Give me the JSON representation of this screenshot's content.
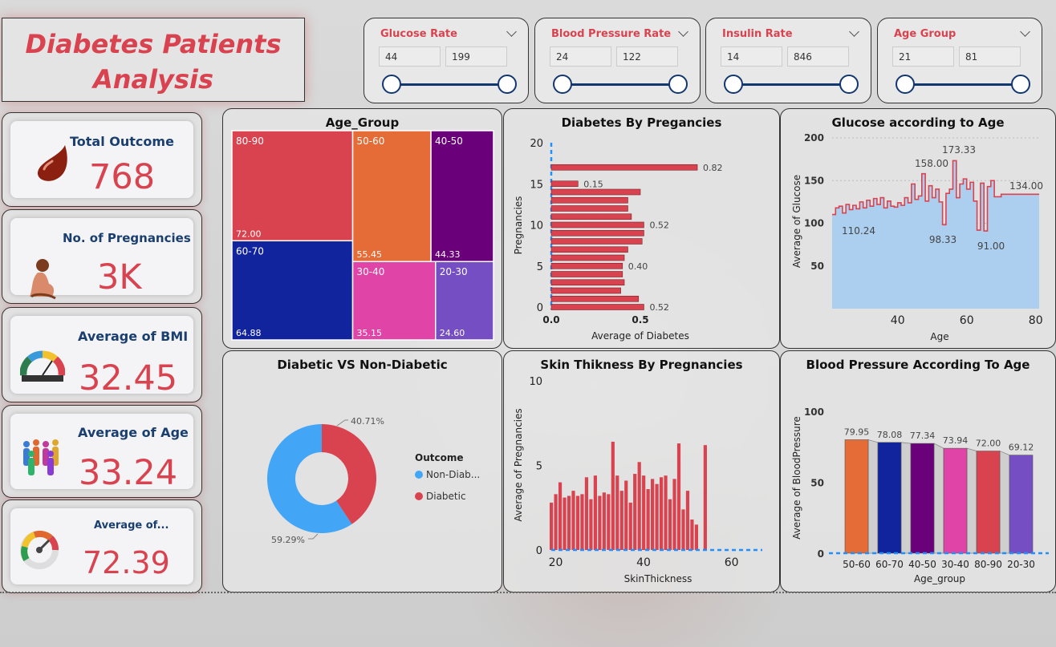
{
  "title": {
    "line1": "Diabetes Patients",
    "line2": "Analysis"
  },
  "slicers": [
    {
      "label": "Glucose Rate",
      "min": "44",
      "max": "199"
    },
    {
      "label": "Blood Pressure Rate",
      "min": "24",
      "max": "122"
    },
    {
      "label": "Insulin Rate",
      "min": "14",
      "max": "846"
    },
    {
      "label": "Age Group",
      "min": "21",
      "max": "81"
    }
  ],
  "kpis": [
    {
      "label": "Total Outcome",
      "value": "768",
      "icon": "blood-drop-icon"
    },
    {
      "label": "No. of Pregnancies",
      "value": "3K",
      "icon": "pregnant-woman-icon"
    },
    {
      "label": "Average of BMI",
      "value": "32.45",
      "icon": "bmi-gauge-icon"
    },
    {
      "label": "Average of Age",
      "value": "33.24",
      "icon": "people-icon"
    },
    {
      "label": "Average of...",
      "value": "72.39",
      "icon": "gauge-icon"
    }
  ],
  "colors": {
    "accent": "#d9434f",
    "navy": "#1a3f6f",
    "blue": "#42a5f5",
    "area": "#a9cdef"
  },
  "chart_data": [
    {
      "type": "treemap",
      "title": "Age_Group",
      "items": [
        {
          "label": "80-90",
          "value": 72.0,
          "display": "72.00",
          "color": "#d9434f"
        },
        {
          "label": "60-70",
          "value": 64.88,
          "display": "64.88",
          "color": "#12239e"
        },
        {
          "label": "50-60",
          "value": 55.45,
          "display": "55.45",
          "color": "#e66c37"
        },
        {
          "label": "40-50",
          "value": 44.33,
          "display": "44.33",
          "color": "#6b007b"
        },
        {
          "label": "30-40",
          "value": 35.15,
          "display": "35.15",
          "color": "#e044a7"
        },
        {
          "label": "20-30",
          "value": 24.6,
          "display": "24.60",
          "color": "#744ec2"
        }
      ]
    },
    {
      "type": "bar",
      "orientation": "horizontal",
      "title": "Diabetes By Pregancies",
      "xlabel": "Average of Diabetes",
      "ylabel": "Pregnancies",
      "xlim": [
        0,
        1
      ],
      "ylim": [
        0,
        20
      ],
      "xticks": [
        "0.0",
        "0.5"
      ],
      "yticks": [
        "0",
        "5",
        "10",
        "15",
        "20"
      ],
      "y": [
        0,
        1,
        2,
        3,
        4,
        5,
        6,
        7,
        8,
        9,
        10,
        11,
        12,
        13,
        14,
        15,
        17
      ],
      "values": [
        0.52,
        0.49,
        0.39,
        0.41,
        0.4,
        0.4,
        0.41,
        0.43,
        0.51,
        0.52,
        0.52,
        0.45,
        0.43,
        0.43,
        0.5,
        0.15,
        0.82
      ],
      "labels": {
        "0": "0.52",
        "5": "0.40",
        "10": "0.52",
        "15": "0.15",
        "17": "0.82"
      }
    },
    {
      "type": "area",
      "title": "Glucose according to Age",
      "xlabel": "Age",
      "ylabel": "Average of Glucose",
      "xlim": [
        21,
        81
      ],
      "ylim": [
        0,
        200
      ],
      "xticks": [
        "40",
        "60",
        "80"
      ],
      "yticks": [
        "50",
        "100",
        "150",
        "200"
      ],
      "x": [
        21,
        22,
        23,
        24,
        25,
        26,
        27,
        28,
        29,
        30,
        31,
        32,
        33,
        34,
        35,
        36,
        37,
        38,
        39,
        40,
        41,
        42,
        43,
        44,
        45,
        46,
        47,
        48,
        49,
        50,
        51,
        52,
        53,
        54,
        55,
        56,
        57,
        58,
        59,
        60,
        61,
        62,
        63,
        64,
        65,
        66,
        67,
        68,
        69,
        70,
        72,
        81
      ],
      "values": [
        110.24,
        118,
        120,
        112,
        122,
        116,
        121,
        117,
        125,
        118,
        127,
        120,
        129,
        122,
        130,
        118,
        126,
        120,
        119,
        124,
        121,
        130,
        124,
        146,
        128,
        132,
        158,
        126,
        144,
        130,
        140,
        125,
        98.33,
        135,
        140,
        173.33,
        130,
        146,
        152,
        140,
        148,
        126,
        92,
        147,
        91,
        143,
        150,
        131,
        131,
        134,
        134,
        134
      ],
      "labels": [
        "110.24",
        "158.00",
        "173.33",
        "98.33",
        "91.00",
        "134.00"
      ]
    },
    {
      "type": "pie",
      "title": "Diabetic VS Non-Diabetic",
      "legend_title": "Outcome",
      "slices": [
        {
          "name": "Non-Diab...",
          "value": 59.29,
          "label": "59.29%",
          "color": "#42a5f5"
        },
        {
          "name": "Diabetic",
          "value": 40.71,
          "label": "40.71%",
          "color": "#d9434f"
        }
      ]
    },
    {
      "type": "bar",
      "title": "Skin Thikness By Pregnancies",
      "xlabel": "SkinThickness",
      "ylabel": "Average of Pregnancies",
      "xlim": [
        19,
        67
      ],
      "ylim": [
        0,
        10
      ],
      "xticks": [
        "20",
        "40",
        "60"
      ],
      "yticks": [
        "0",
        "5",
        "10"
      ],
      "x": [
        19,
        20,
        21,
        22,
        23,
        24,
        25,
        26,
        27,
        28,
        29,
        30,
        31,
        32,
        33,
        34,
        35,
        36,
        37,
        38,
        39,
        40,
        41,
        42,
        43,
        44,
        45,
        46,
        47,
        48,
        49,
        50,
        51,
        52,
        54
      ],
      "values": [
        2.8,
        3.3,
        4.0,
        3.1,
        3.2,
        3.5,
        3.2,
        3.3,
        4.3,
        3.0,
        4.4,
        3.2,
        3.4,
        3.3,
        6.4,
        4.4,
        3.5,
        4.1,
        2.8,
        4.5,
        5.2,
        4.4,
        3.6,
        4.2,
        3.9,
        4.3,
        4.4,
        3.0,
        4.2,
        6.3,
        2.4,
        3.5,
        1.8,
        1.5,
        6.2
      ]
    },
    {
      "type": "bar",
      "title": "Blood Pressure According To Age",
      "xlabel": "Age_group",
      "ylabel": "Average of BloodPressure",
      "ylim": [
        0,
        100
      ],
      "yticks": [
        "0",
        "50",
        "100"
      ],
      "categories": [
        "50-60",
        "60-70",
        "40-50",
        "30-40",
        "80-90",
        "20-30"
      ],
      "values": [
        79.95,
        78.08,
        77.34,
        73.94,
        72.0,
        69.12
      ],
      "labels": [
        "79.95",
        "78.08",
        "77.34",
        "73.94",
        "72.00",
        "69.12"
      ],
      "colors": [
        "#e66c37",
        "#12239e",
        "#6b007b",
        "#e044a7",
        "#d9434f",
        "#744ec2"
      ]
    }
  ]
}
